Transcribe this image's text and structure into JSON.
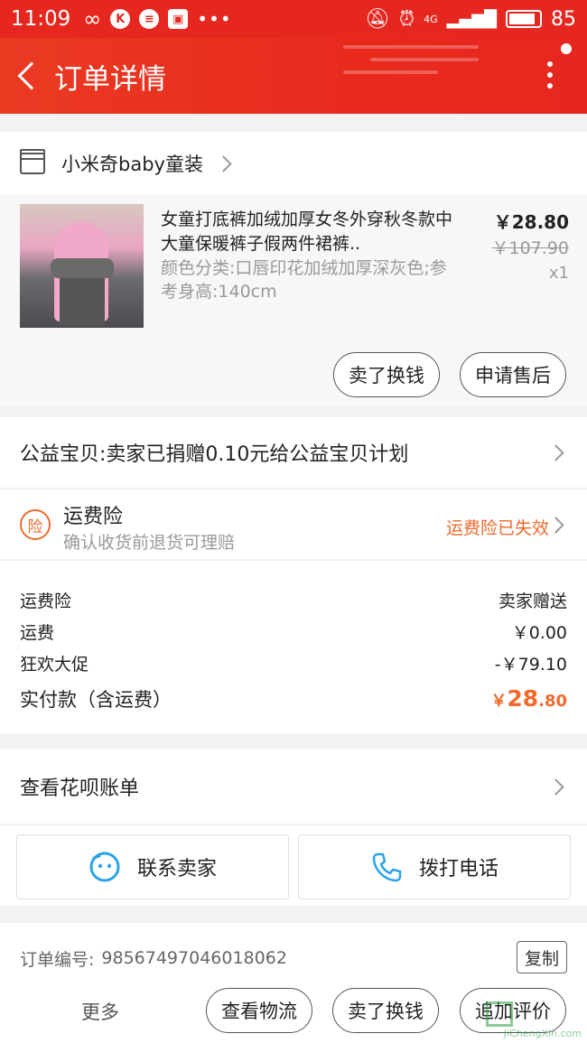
{
  "status_bar": {
    "time": "11:09",
    "signal": "4G",
    "battery": "85"
  },
  "nav": {
    "title": "订单详情"
  },
  "shop": {
    "name": "小米奇baby童装"
  },
  "product": {
    "title": "女童打底裤加绒加厚女冬外穿秋冬款中大童保暖裤子假两件裙裤..",
    "spec": "颜色分类:口唇印花加绒加厚深灰色;参考身高:140cm",
    "price": "￥28.80",
    "original_price": "￥107.90",
    "quantity": "x1",
    "btn_sell": "卖了换钱",
    "btn_after_sale": "申请售后"
  },
  "charity": {
    "text": "公益宝贝:卖家已捐赠0.10元给公益宝贝计划"
  },
  "insurance": {
    "badge": "险",
    "title": "运费险",
    "subtitle": "确认收货前退货可理赔",
    "status": "运费险已失效"
  },
  "fees": [
    {
      "label": "运费险",
      "value": "卖家赠送"
    },
    {
      "label": "运费",
      "value": "￥0.00"
    },
    {
      "label": "狂欢大促",
      "value": "-￥79.10"
    }
  ],
  "total": {
    "label": "实付款（含运费）",
    "currency": "￥",
    "integer": "28",
    "decimal": ".80"
  },
  "huabei": {
    "text": "查看花呗账单"
  },
  "contact": {
    "seller": "联系卖家",
    "phone": "拨打电话"
  },
  "order": {
    "label": "订单编号:",
    "number": "98567497046018062",
    "copy": "复制"
  },
  "footer": {
    "more": "更多",
    "logistics": "查看物流",
    "sell": "卖了换钱",
    "review": "追加评价"
  },
  "watermark": {
    "text": "JiChengXin.com"
  },
  "colors": {
    "brand_red": "#e5271f",
    "accent_orange": "#f06a2c"
  }
}
